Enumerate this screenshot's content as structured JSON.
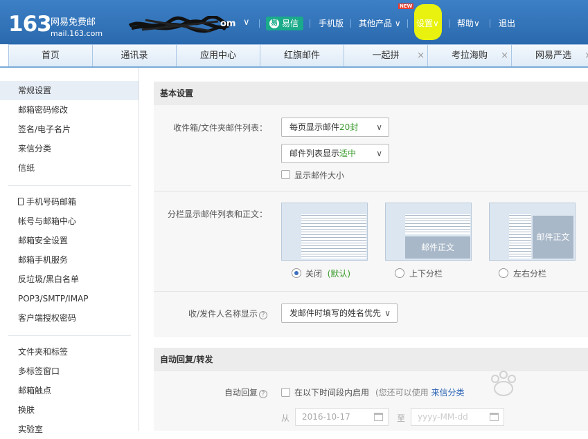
{
  "header": {
    "logo_number": "163",
    "logo_title": "网易免费邮",
    "logo_domain": "mail.163.com",
    "account_suffix": "om",
    "account_caret": "∨",
    "yixin_label": "易信",
    "links": {
      "mobile": "手机版",
      "other_products": "其他产品",
      "settings": "设置",
      "help": "帮助",
      "logout": "退出"
    },
    "caret": "∨"
  },
  "tabs": [
    {
      "label": "首页",
      "closable": false
    },
    {
      "label": "通讯录",
      "closable": false
    },
    {
      "label": "应用中心",
      "closable": false
    },
    {
      "label": "红旗邮件",
      "closable": false
    },
    {
      "label": "一起拼",
      "closable": true,
      "badge": "NEW"
    },
    {
      "label": "考拉海购",
      "closable": true
    },
    {
      "label": "网易严选",
      "closable": true
    }
  ],
  "tab_close": "×",
  "sidebar": {
    "group1": [
      "常规设置",
      "邮箱密码修改",
      "签名/电子名片",
      "来信分类",
      "信纸"
    ],
    "group2": [
      "手机号码邮箱",
      "帐号与邮箱中心",
      "邮箱安全设置",
      "邮箱手机服务",
      "反垃圾/黑白名单",
      "POP3/SMTP/IMAP",
      "客户端授权密码"
    ],
    "group3": [
      "文件夹和标签",
      "多标签窗口",
      "邮箱触点",
      "换肤",
      "实验室"
    ],
    "active": "常规设置"
  },
  "basic": {
    "title": "基本设置",
    "list_label": "收件箱/文件夹邮件列表：",
    "per_page_prefix": "每页显示邮件",
    "per_page_value": "20封",
    "list_display_prefix": "邮件列表显示",
    "list_display_value": "适中",
    "show_size": "显示邮件大小",
    "split_label": "分栏显示邮件列表和正文：",
    "split_options": [
      {
        "label": "关闭",
        "extra": "(默认)",
        "selected": true
      },
      {
        "label": "上下分栏",
        "selected": false
      },
      {
        "label": "左右分栏",
        "selected": false
      }
    ],
    "body_text": "邮件正文",
    "name_label": "收/发件人名称显示",
    "name_value": "发邮件时填写的姓名优先",
    "help_mark": "?"
  },
  "auto": {
    "title": "自动回复/转发",
    "reply_label": "自动回复",
    "enable_text": "在以下时间段内启用",
    "note_prefix": "(您还可以使用",
    "note_link": "来信分类",
    "from_label": "从",
    "from_date": "2016-10-17",
    "to_label": "至",
    "to_placeholder": "yyyy-MM-dd"
  },
  "caret": "∨",
  "colors": {
    "header_blue": "#2b69ad",
    "accent_green": "#3a9b2c",
    "yixin_green": "#1aab8a",
    "highlight_yellow": "#e8f20e"
  }
}
